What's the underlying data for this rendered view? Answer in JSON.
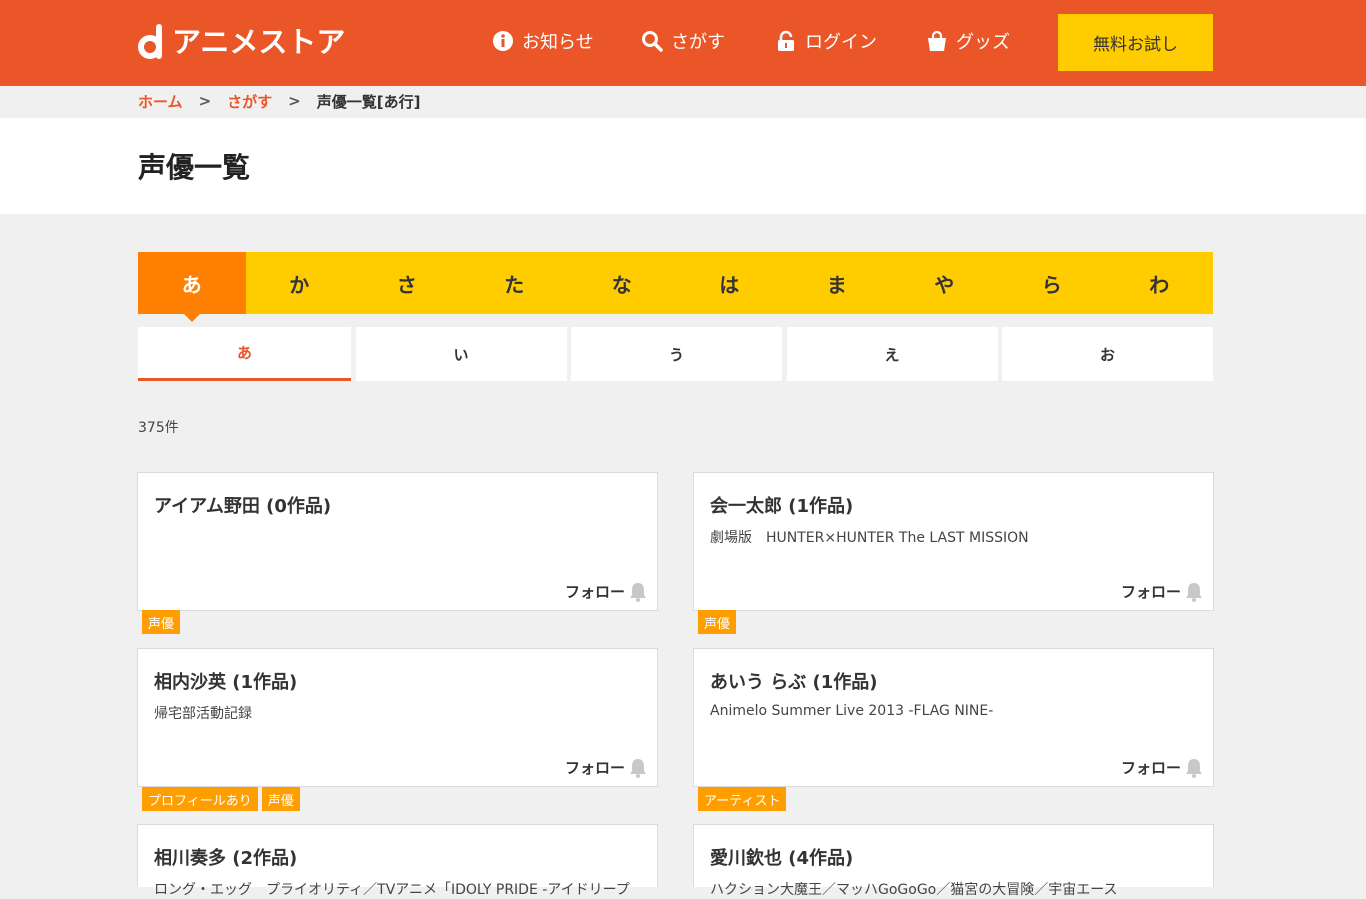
{
  "header": {
    "logo_text": "アニメストア",
    "nav": {
      "info": "お知らせ",
      "search": "さがす",
      "login": "ログイン",
      "goods": "グッズ"
    },
    "trial_button": "無料お試し",
    "bg_color": "#ea5628"
  },
  "breadcrumb": {
    "home": "ホーム",
    "search": "さがす",
    "current": "声優一覧[あ行]",
    "separator": ">"
  },
  "page_title": "声優一覧",
  "row_tabs": [
    "あ",
    "か",
    "さ",
    "た",
    "な",
    "は",
    "ま",
    "や",
    "ら",
    "わ"
  ],
  "row_tab_active": "あ",
  "sub_tabs": [
    "あ",
    "い",
    "う",
    "え",
    "お"
  ],
  "sub_tab_active": "あ",
  "result_count": "375件",
  "follow_label": "フォロー",
  "cards": [
    {
      "name": "アイアム野田 (0作品)",
      "work": "",
      "tags": [
        "声優"
      ]
    },
    {
      "name": "会一太郎 (1作品)",
      "work": "劇場版　HUNTER×HUNTER The LAST MISSION",
      "tags": [
        "声優"
      ]
    },
    {
      "name": "相内沙英 (1作品)",
      "work": "帰宅部活動記録",
      "tags": [
        "プロフィールあり",
        "声優"
      ]
    },
    {
      "name": "あいう らぶ (1作品)",
      "work": "Animelo Summer Live 2013 -FLAG NINE-",
      "tags": [
        "アーティスト"
      ]
    },
    {
      "name": "相川奏多 (2作品)",
      "work": "ロング・エッグ　プライオリティ／TVアニメ「IDOLY PRIDE -アイドリープ",
      "tags": []
    },
    {
      "name": "愛川欽也 (4作品)",
      "work": "ハクション大魔王／マッハGoGoGo／猫宮の大冒険／宇宙エース",
      "tags": []
    }
  ],
  "colors": {
    "accent": "#ea5628",
    "yellow": "#ffcc00",
    "orange_active": "#ff7f00",
    "tag": "#ff9e00"
  }
}
